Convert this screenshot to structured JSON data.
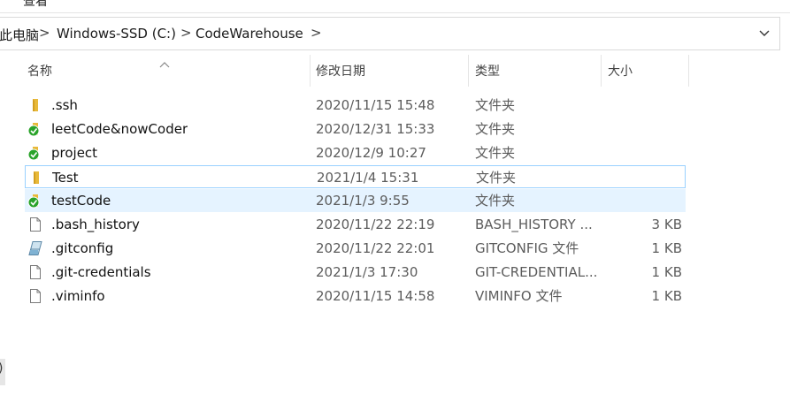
{
  "ribbon": {
    "label": "查看"
  },
  "breadcrumb": {
    "items": [
      "此电脑",
      "Windows-SSD (C:)",
      "CodeWarehouse"
    ],
    "separator": ">"
  },
  "columns": {
    "name": "名称",
    "date": "修改日期",
    "type": "类型",
    "size": "大小"
  },
  "files": [
    {
      "name": ".ssh",
      "date": "2020/11/15 15:48",
      "type": "文件夹",
      "size": "",
      "icon": "folder-icon"
    },
    {
      "name": "leetCode&nowCoder",
      "date": "2020/12/31 15:33",
      "type": "文件夹",
      "size": "",
      "icon": "folder-synced-icon"
    },
    {
      "name": "project",
      "date": "2020/12/9 10:27",
      "type": "文件夹",
      "size": "",
      "icon": "folder-synced-icon"
    },
    {
      "name": "Test",
      "date": "2021/1/4 15:31",
      "type": "文件夹",
      "size": "",
      "icon": "folder-icon"
    },
    {
      "name": "testCode",
      "date": "2021/1/3 9:55",
      "type": "文件夹",
      "size": "",
      "icon": "folder-synced-icon"
    },
    {
      "name": ".bash_history",
      "date": "2020/11/22 22:19",
      "type": "BASH_HISTORY ...",
      "size": "3 KB",
      "icon": "file-icon"
    },
    {
      "name": ".gitconfig",
      "date": "2020/11/22 22:01",
      "type": "GITCONFIG 文件",
      "size": "1 KB",
      "icon": "config-file-icon"
    },
    {
      "name": ".git-credentials",
      "date": "2021/1/3 17:30",
      "type": "GIT-CREDENTIAL...",
      "size": "1 KB",
      "icon": "file-icon"
    },
    {
      "name": ".viminfo",
      "date": "2020/11/15 14:58",
      "type": "VIMINFO 文件",
      "size": "1 KB",
      "icon": "file-icon"
    }
  ],
  "left_edge_text": ")",
  "colors": {
    "hover_bg": "#e5f3ff",
    "focus_border": "#99d1ff",
    "folder": "#e8b93a",
    "sync_green": "#2aa32a"
  }
}
